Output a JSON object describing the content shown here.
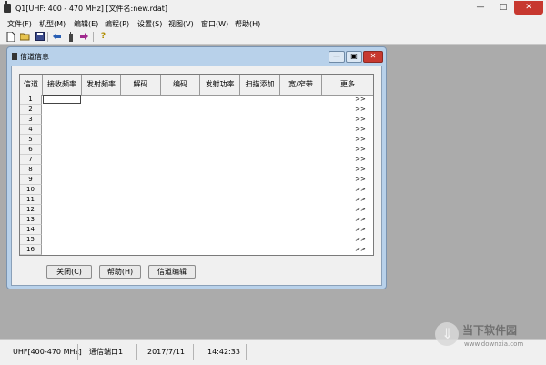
{
  "window": {
    "title": "Q1[UHF: 400 - 470 MHz] [文件名:new.rdat]",
    "minimize": "—",
    "maximize": "□",
    "close": "✕"
  },
  "menu": {
    "items": [
      "文件(F)",
      "机型(M)",
      "编辑(E)",
      "编程(P)",
      "设置(S)",
      "视图(V)",
      "窗口(W)",
      "帮助(H)"
    ]
  },
  "toolbar": {
    "icons": [
      "new-file-icon",
      "open-folder-icon",
      "save-icon",
      "arrow-left-icon",
      "read-radio-icon",
      "arrow-right-icon",
      "help-icon"
    ]
  },
  "child_window": {
    "title": "信道信息",
    "minimize": "—",
    "maximize": "▣",
    "close": "✕"
  },
  "grid": {
    "columns": [
      "信道",
      "接收频率",
      "发射频率",
      "解码",
      "编码",
      "发射功率",
      "扫描添加",
      "宽/窄带",
      "更多"
    ],
    "rows": [
      "1",
      "2",
      "3",
      "4",
      "5",
      "6",
      "7",
      "8",
      "9",
      "10",
      "11",
      "12",
      "13",
      "14",
      "15",
      "16"
    ],
    "more_label": ">>"
  },
  "buttons": {
    "close": "关闭(C)",
    "help": "帮助(H)",
    "channel_edit": "信道编辑"
  },
  "status": {
    "band": "UHF[400-470 MHz]",
    "port": "通信端口1",
    "date": "2017/7/11",
    "time": "14:42:33"
  },
  "watermark": {
    "text": "当下软件园",
    "url": "www.downxia.com"
  }
}
